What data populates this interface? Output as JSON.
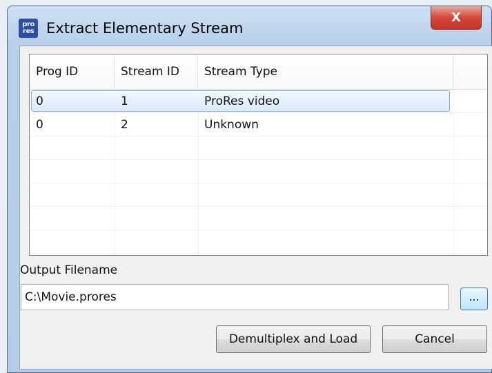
{
  "window": {
    "title": "Extract Elementary Stream",
    "icon_text": "pro res",
    "close_glyph": "X"
  },
  "stream_list": {
    "columns": [
      "Prog ID",
      "Stream ID",
      "Stream Type"
    ],
    "rows": [
      {
        "prog_id": "0",
        "stream_id": "1",
        "stream_type": "ProRes video",
        "selected": true
      },
      {
        "prog_id": "0",
        "stream_id": "2",
        "stream_type": "Unknown",
        "selected": false
      }
    ]
  },
  "output": {
    "label": "Output Filename",
    "value": "C:\\Movie.prores",
    "browse_label": "..."
  },
  "buttons": {
    "demux_label": "Demultiplex and Load",
    "cancel_label": "Cancel"
  },
  "colors": {
    "selection": "#dbeafc",
    "close_button": "#c73427",
    "title_bar": "#b9d0ea"
  }
}
